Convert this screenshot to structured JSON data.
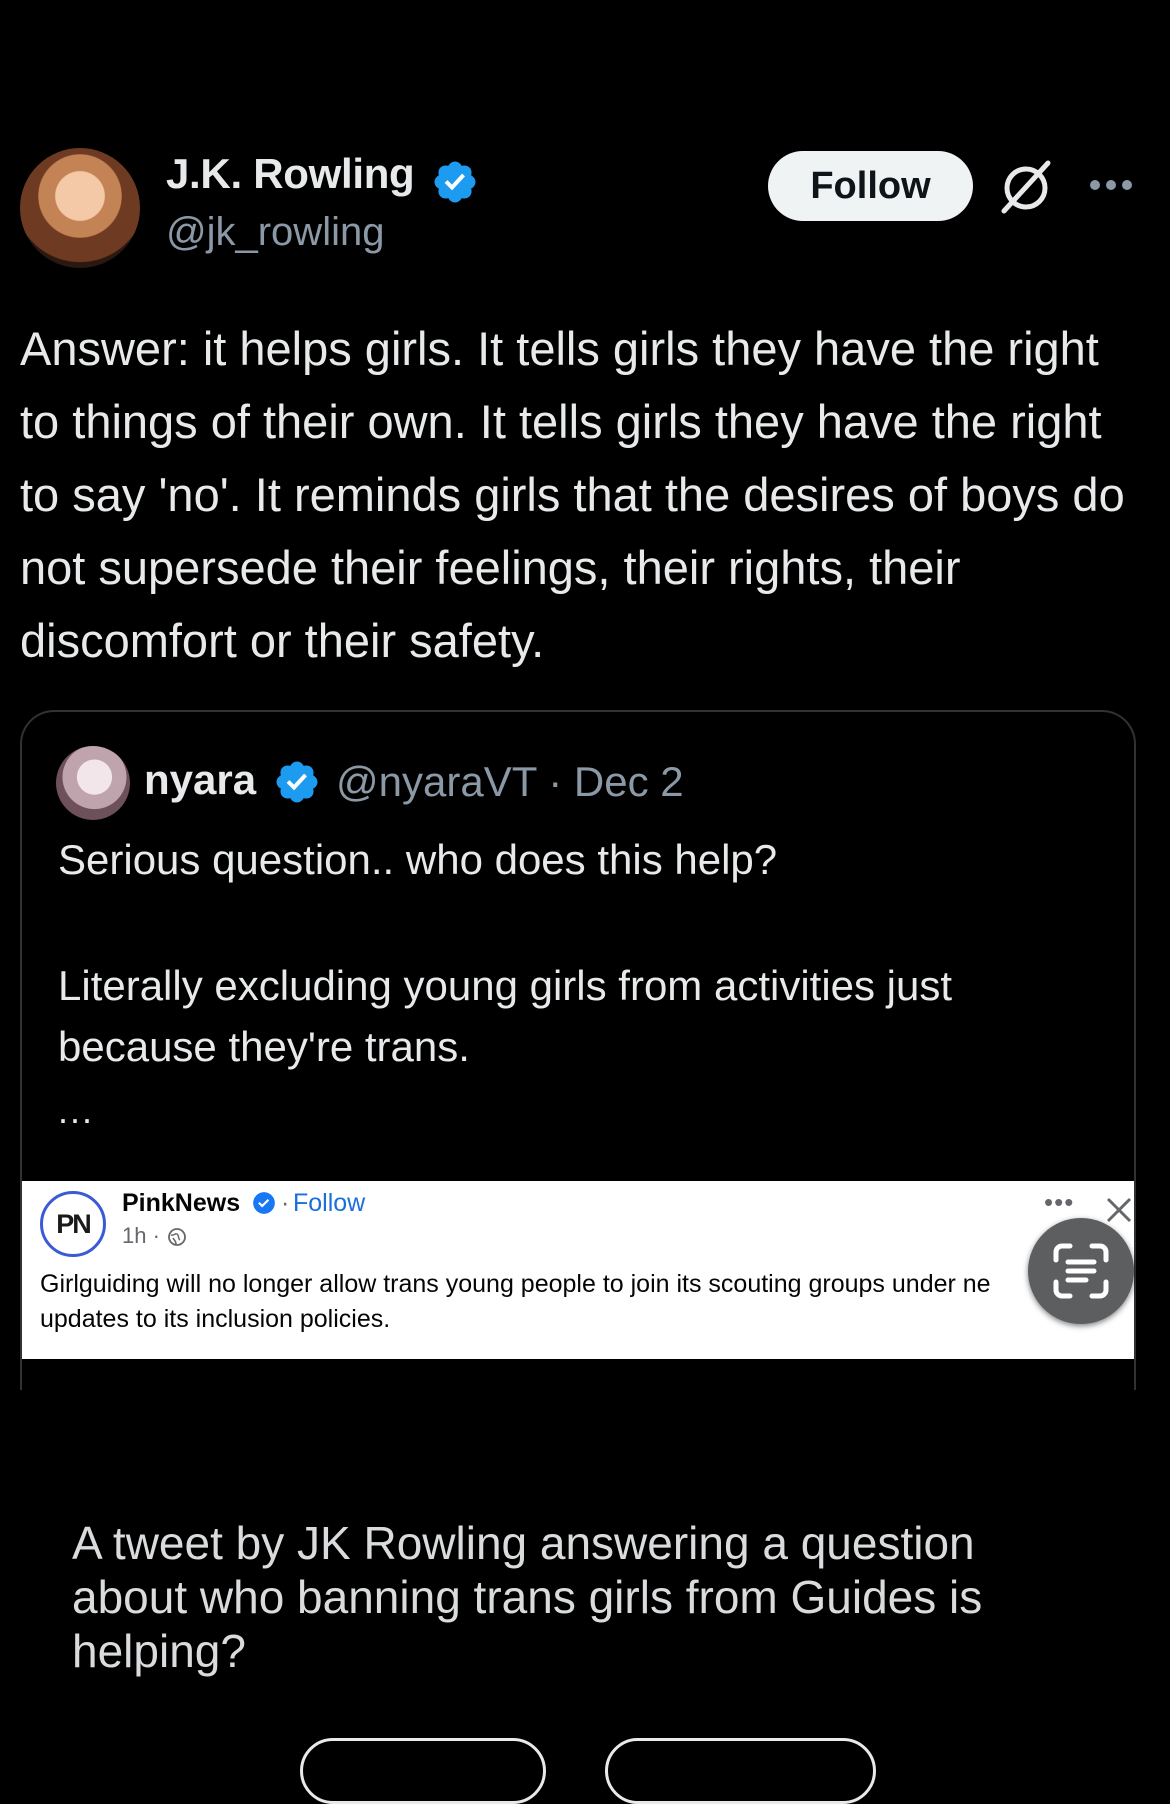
{
  "author": {
    "name": "J.K. Rowling",
    "handle": "@jk_rowling",
    "follow_label": "Follow"
  },
  "tweet": {
    "text": "Answer: it helps girls. It tells girls they have the right to things of their own. It tells girls they have the right to say 'no'. It reminds girls that the desires of boys do not supersede their feelings, their rights, their discomfort or their safety."
  },
  "quote": {
    "name": "nyara",
    "handle": "@nyaraVT",
    "date": "Dec 2",
    "meta": "@nyaraVT · Dec 2",
    "line1": "Serious question.. who does this help?",
    "line2": "Literally excluding young girls from activities just because they're trans.",
    "ellipsis": "...",
    "embed": {
      "source_name": "PinkNews",
      "logo_text": "PN",
      "follow_label": "Follow",
      "time": "1h ·",
      "body": "Girlguiding will no longer allow trans young people to join its scouting groups under ne",
      "body_line2": "updates to its inclusion policies."
    }
  },
  "caption": "A tweet by JK Rowling answering a question about who banning trans girls from Guides is helping?",
  "icons": {
    "verified": "verified-badge-icon",
    "grok": "grok-icon",
    "more": "more-options-icon",
    "scan": "text-scan-icon",
    "globe": "globe-icon",
    "close": "close-icon"
  },
  "colors": {
    "background": "#000000",
    "verified_blue": "#1d9bf0",
    "secondary_text": "#8b98a5",
    "facebook_blue": "#1b6fd8"
  }
}
